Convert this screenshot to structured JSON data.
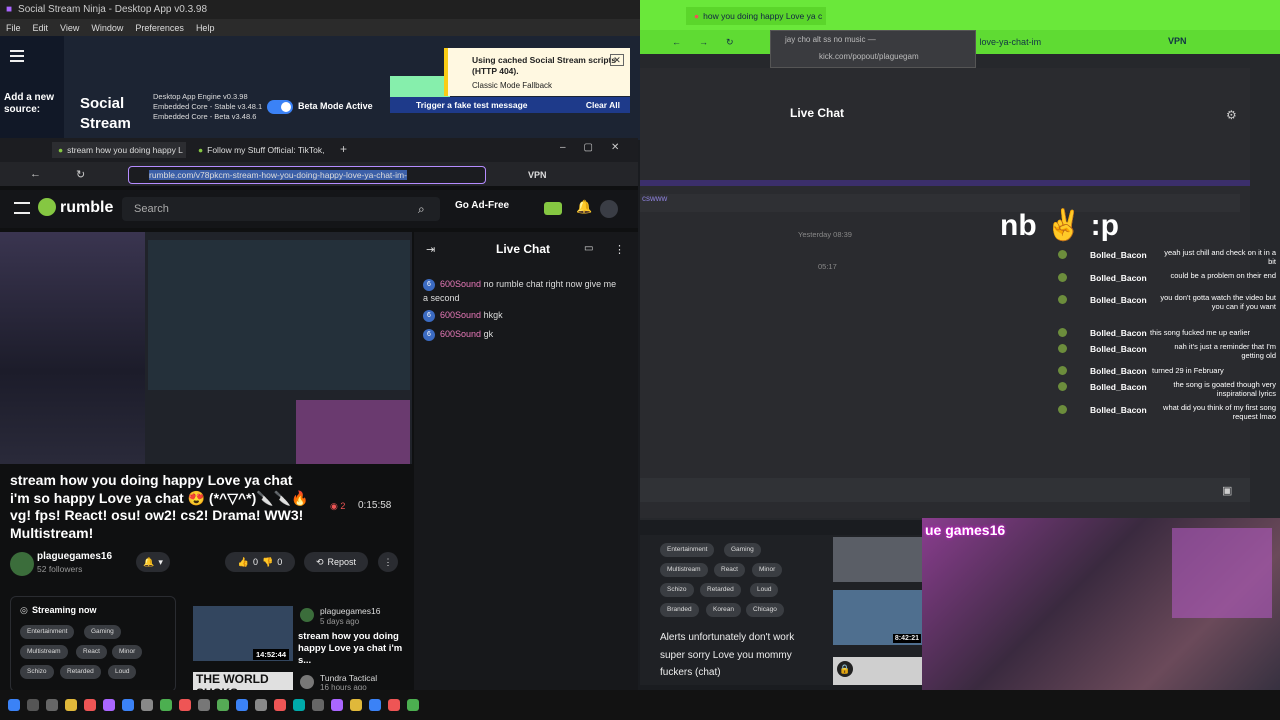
{
  "ssn": {
    "title": "Social Stream Ninja - Desktop App v0.3.98",
    "menu": [
      "File",
      "Edit",
      "View",
      "Window",
      "Preferences",
      "Help"
    ],
    "add_source": "Add a new source:",
    "logo": "Social Stream",
    "versions": [
      "Desktop App Engine   v0.3.98",
      "Embedded Core - Stable   v3.48.1",
      "Embedded Core - Beta   v3.48.6"
    ],
    "beta_mode": "Beta Mode Active",
    "fake_test": "Trigger a fake test message",
    "clear_all": "Clear All",
    "notice_title": "Using cached Social Stream scripts (HTTP 404).",
    "notice_sub": "Classic Mode Fallback"
  },
  "right_browser": {
    "tab": "how you doing happy Love ya c",
    "popup": "jay cho alt ss no music —",
    "popup_url": "kick.com/popout/plaguegam",
    "vpn": "VPN",
    "url_frag": "love-ya-chat-im",
    "live_chat": "Live Chat",
    "channel_tag": "cswww",
    "emote": "nb ✌ :p",
    "yesterday": "Yesterday 08:39",
    "time2": "05:17",
    "messages": [
      {
        "user": "Bolled_Bacon",
        "text": "yeah just chill and check on it in a bit"
      },
      {
        "user": "Bolled_Bacon",
        "text": "could be a problem on their end"
      },
      {
        "user": "Bolled_Bacon",
        "text": "you don't gotta watch the video but you can if you want"
      },
      {
        "user": "Bolled_Bacon",
        "text": "this song fucked me up earlier"
      },
      {
        "user": "Bolled_Bacon",
        "text": "nah it's just a reminder that I'm getting old"
      },
      {
        "user": "Bolled_Bacon",
        "text": "turned 29 in February"
      },
      {
        "user": "Bolled_Bacon",
        "text": "the song is goated though very inspirational lyrics"
      },
      {
        "user": "Bolled_Bacon",
        "text": "what did you think of my first song request lmao"
      }
    ]
  },
  "rumble_side": {
    "tags": [
      "Entertainment",
      "Gaming",
      "Multistream",
      "React",
      "Minor",
      "Schizo",
      "Retarded",
      "Loud",
      "Branded",
      "Korean",
      "Chicago"
    ],
    "alerts": "Alerts unfortunately don't work super sorry Love you mommy fuckers (chat)",
    "thumb_dur": "8:42:21"
  },
  "webcam": {
    "label": "ue games16"
  },
  "rumble": {
    "tab1": "stream how you doing happy L",
    "tab2": "Follow my Stuff Official: TikTok,",
    "url": "rumble.com/v78pkcm-stream-how-you-doing-happy-love-ya-chat-im-",
    "vpn": "VPN",
    "logo": "rumble",
    "search_placeholder": "Search",
    "go_ad_free": "Go Ad-Free",
    "title": "stream how you doing happy Love ya chat i'm so happy Love ya chat 😍 (*^▽^*)🔪🔪🔥 vg! fps! React! osu! ow2! cs2! Drama! WW3! Multistream!",
    "views": "2",
    "duration": "0:15:58",
    "channel": "plaguegames16",
    "followers": "52 followers",
    "likes": "0",
    "dislikes": "0",
    "repost": "Repost",
    "chat_title": "Live Chat",
    "chat": [
      {
        "badge": "6",
        "user": "600Sound",
        "text": "no rumble chat right now give me a second"
      },
      {
        "badge": "6",
        "user": "600Sound",
        "text": "hkgk"
      },
      {
        "badge": "6",
        "user": "600Sound",
        "text": "gk"
      }
    ],
    "streaming_now": "Streaming now",
    "stream_tags": [
      "Entertainment",
      "Gaming",
      "Multistream",
      "React",
      "Minor",
      "Schizo",
      "Retarded",
      "Loud"
    ],
    "rec1": {
      "channel": "plaguegames16",
      "ago": "5 days ago",
      "title": "stream how you doing happy Love ya chat i'm s...",
      "duration": "14:52:44"
    },
    "rec2": {
      "channel": "Tundra Tactical",
      "ago": "16 hours ago",
      "thumb": "THE WORLD SUCKS"
    }
  },
  "colors": {
    "accent": "#85c742",
    "kick_green": "#6ae83a",
    "chat_user": "#e879b9"
  }
}
